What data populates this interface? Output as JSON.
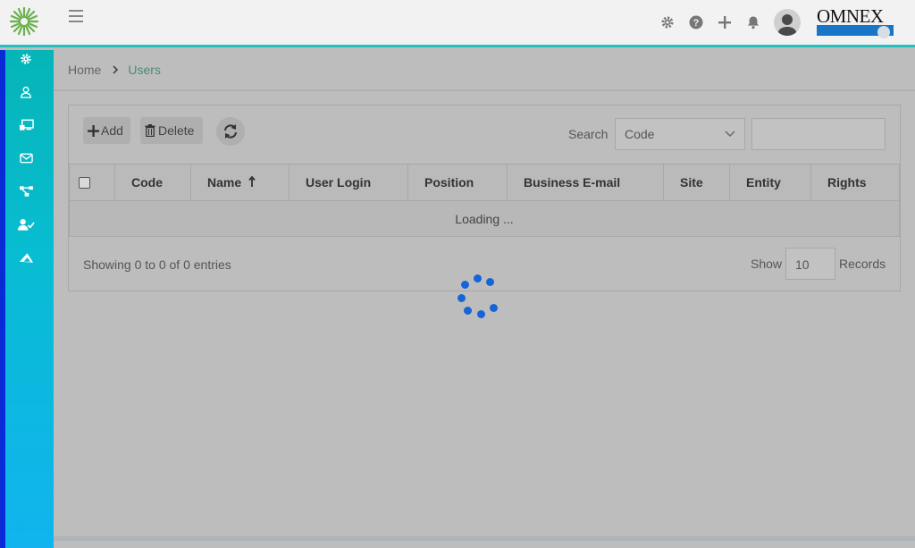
{
  "topbar": {
    "brand": "OMNEX",
    "icons": [
      "gear-icon",
      "help-icon",
      "plus-icon",
      "bell-icon",
      "user-avatar"
    ]
  },
  "sidebar": {
    "items": [
      "settings-icon",
      "user-icon",
      "monitor-icon",
      "mail-icon",
      "org-chart-icon",
      "user-check-icon",
      "origami-icon"
    ]
  },
  "breadcrumb": {
    "home": "Home",
    "current": "Users"
  },
  "toolbar": {
    "add_label": "Add",
    "delete_label": "Delete"
  },
  "search": {
    "label": "Search",
    "field_selected": "Code",
    "value": ""
  },
  "table": {
    "columns": [
      "Code",
      "Name",
      "User Login",
      "Position",
      "Business E-mail",
      "Site",
      "Entity",
      "Rights"
    ],
    "loading_text": "Loading ..."
  },
  "footer": {
    "showing_text": "Showing 0 to 0 of 0 entries",
    "show_label": "Show",
    "page_size": "10",
    "records_label": "Records"
  },
  "colors": {
    "accent": "#26c0c0",
    "link": "#4a8d74",
    "spinner": "#1565d8",
    "sidebar_edge": "#0a2ad8"
  }
}
